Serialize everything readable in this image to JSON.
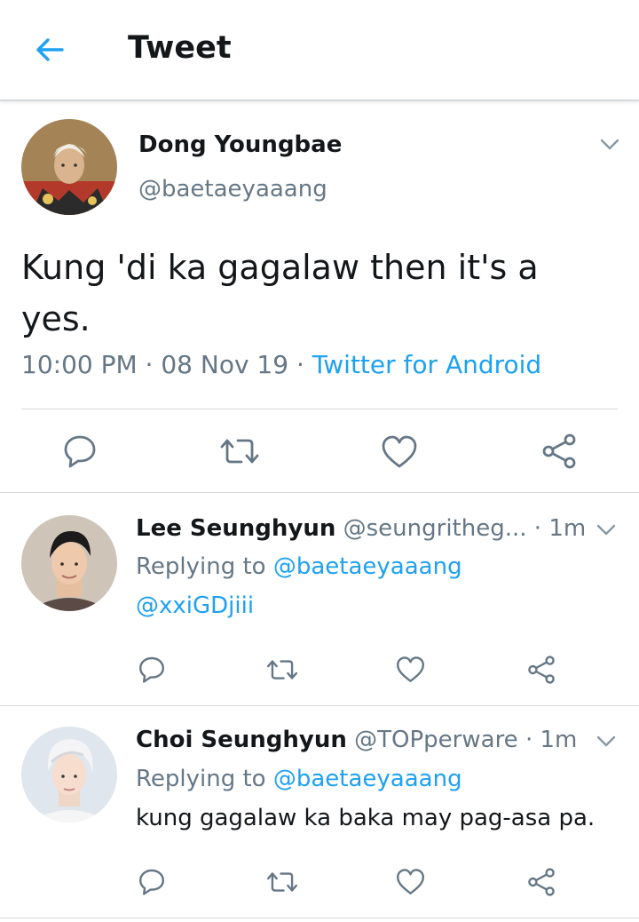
{
  "header": {
    "title": "Tweet",
    "back_icon": "arrow-left-icon",
    "accent": "#1da1f2"
  },
  "tweet": {
    "name": "Dong Youngbae",
    "handle": "@baetaeyaaang",
    "text": "Kung 'di ka gagalaw then it's a yes.",
    "time": "10:00 PM",
    "date": "08 Nov 19",
    "separator": "·",
    "source": "Twitter for Android"
  },
  "replies": [
    {
      "name": "Lee Seunghyun",
      "handle": "@seungritheg...",
      "time": "1m",
      "replying_label": "Replying to",
      "replying_to": "@baetaeyaaang",
      "text": "@xxiGDjiii"
    },
    {
      "name": "Choi Seunghyun",
      "handle": "@TOPperware",
      "time": "1m",
      "replying_label": "Replying to",
      "replying_to": "@baetaeyaaang",
      "text": "kung gagalaw ka baka may pag-asa pa."
    }
  ],
  "actions": [
    "reply-icon",
    "retweet-icon",
    "like-icon",
    "share-icon"
  ]
}
